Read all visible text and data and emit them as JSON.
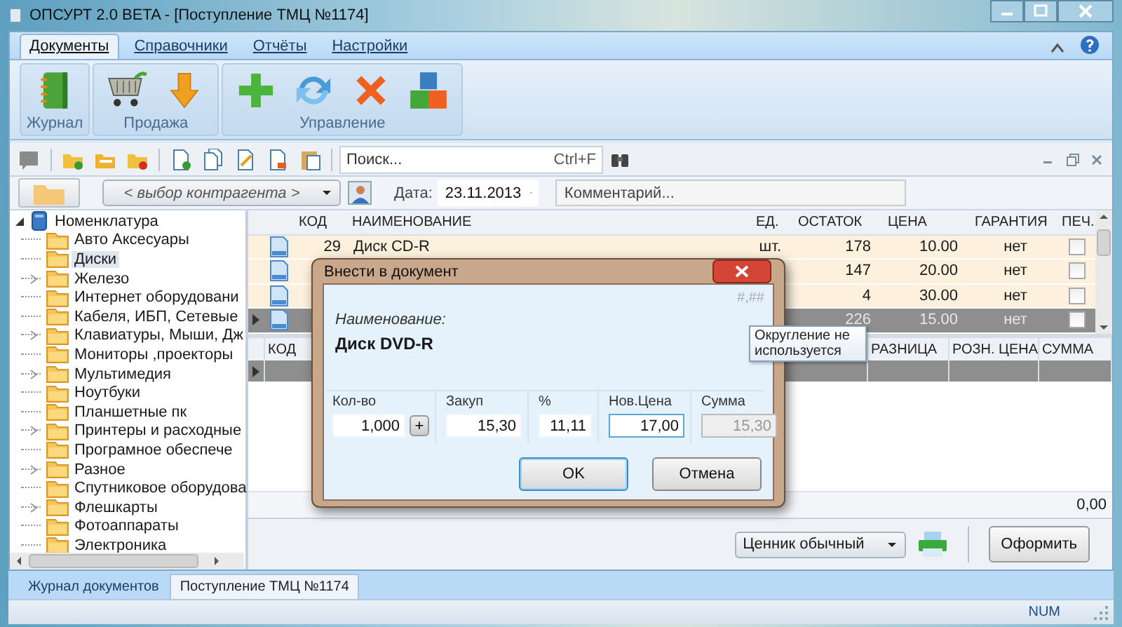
{
  "window": {
    "title": "ОПСУРТ 2.0 BETA - [Поступление ТМЦ №1174]"
  },
  "ribbon": {
    "tabs": [
      {
        "label": "Документы",
        "selected": true
      },
      {
        "label": "Справочники",
        "selected": false
      },
      {
        "label": "Отчёты",
        "selected": false
      },
      {
        "label": "Настройки",
        "selected": false
      }
    ],
    "groups": [
      {
        "label": "Журнал",
        "buttons": [
          {
            "kind": "notebook"
          }
        ]
      },
      {
        "label": "Продажа",
        "buttons": [
          {
            "kind": "cart"
          },
          {
            "kind": "arrow"
          }
        ]
      },
      {
        "label": "Управление",
        "buttons": [
          {
            "kind": "plus"
          },
          {
            "kind": "refresh"
          },
          {
            "kind": "cross"
          },
          {
            "kind": "blocks"
          }
        ]
      }
    ]
  },
  "toolbar": {
    "search": {
      "placeholder": "Поиск..."
    },
    "shortcut": "Ctrl+F"
  },
  "document": {
    "contractor": "< выбор контрагента >",
    "date_label": "Дата:",
    "date": "23.11.2013",
    "comment": {
      "placeholder": "Комментарий..."
    }
  },
  "tree": {
    "label": "Номенклатура",
    "expanded": true,
    "children": [
      {
        "label": "Авто Аксесуары",
        "has_children": false,
        "selected": false
      },
      {
        "label": "Диски",
        "has_children": false,
        "selected": true
      },
      {
        "label": "Железо",
        "has_children": true,
        "selected": false
      },
      {
        "label": "Интернет оборудовани",
        "has_children": false,
        "selected": false
      },
      {
        "label": "Кабеля, ИБП, Сетевые",
        "has_children": false,
        "selected": false
      },
      {
        "label": "Клавиатуры, Мыши, Дж",
        "has_children": true,
        "selected": false
      },
      {
        "label": "Мониторы ,проекторы",
        "has_children": false,
        "selected": false
      },
      {
        "label": "Мультимедия",
        "has_children": true,
        "selected": false
      },
      {
        "label": "Ноутбуки",
        "has_children": false,
        "selected": false
      },
      {
        "label": "Планшетные пк",
        "has_children": false,
        "selected": false
      },
      {
        "label": "Принтеры и расходные",
        "has_children": true,
        "selected": false
      },
      {
        "label": "Програмное обеспече",
        "has_children": false,
        "selected": false
      },
      {
        "label": "Разное",
        "has_children": true,
        "selected": false
      },
      {
        "label": "Спутниковое оборудова",
        "has_children": false,
        "selected": false
      },
      {
        "label": "Флешкарты",
        "has_children": true,
        "selected": false
      },
      {
        "label": "Фотоаппараты",
        "has_children": false,
        "selected": false
      },
      {
        "label": "Электроника",
        "has_children": false,
        "selected": false
      }
    ]
  },
  "items_table": {
    "columns": [
      "КОД",
      "НАИМЕНОВАНИЕ",
      "ЕД.",
      "ОСТАТОК",
      "ЦЕНА",
      "ГАРАНТИЯ",
      "ПЕЧ."
    ],
    "rows": [
      {
        "code": "29",
        "name": "Диск CD-R",
        "unit": "шт.",
        "stock": "178",
        "price": "10.00",
        "warranty": "нет",
        "print": false,
        "selected": false
      },
      {
        "stock": "147",
        "price": "20.00",
        "warranty": "нет",
        "print": false,
        "selected": false
      },
      {
        "stock": "4",
        "price": "30.00",
        "warranty": "нет",
        "print": false,
        "selected": false
      },
      {
        "stock": "226",
        "price": "15.00",
        "warranty": "нет",
        "print": false,
        "selected": true
      }
    ]
  },
  "lines_table": {
    "columns": [
      "КОД",
      "РАЗНИЦА",
      "РОЗН. ЦЕНА",
      "СУММА"
    ],
    "rows": [
      {
        "selected": true
      }
    ],
    "total": "0,00"
  },
  "footer": {
    "price_tag": "Ценник обычный",
    "submit": "Оформить"
  },
  "dialog": {
    "title": "Внести в документ",
    "rounding": "#,##",
    "name_label": "Наименование:",
    "name": "Диск DVD-R",
    "fields": [
      {
        "label": "Кол-во",
        "value": "1,000",
        "button": "+",
        "focused": false,
        "disabled": false
      },
      {
        "label": "Закуп",
        "value": "15,30",
        "focused": false,
        "disabled": false
      },
      {
        "label": "%",
        "value": "11,11",
        "focused": false,
        "disabled": false
      },
      {
        "label": "Нов.Цена",
        "value": "17,00",
        "focused": true,
        "disabled": false
      },
      {
        "label": "Сумма",
        "value": "15,30",
        "focused": false,
        "disabled": true
      }
    ],
    "buttons": [
      {
        "label": "OK",
        "default": true
      },
      {
        "label": "Отмена",
        "default": false
      }
    ]
  },
  "tooltip": "Округление не используется",
  "doc_tabs": [
    {
      "label": "Журнал документов",
      "selected": false
    },
    {
      "label": "Поступление ТМЦ №1174",
      "selected": true
    }
  ],
  "status_bar": {
    "indicator": "NUM"
  }
}
